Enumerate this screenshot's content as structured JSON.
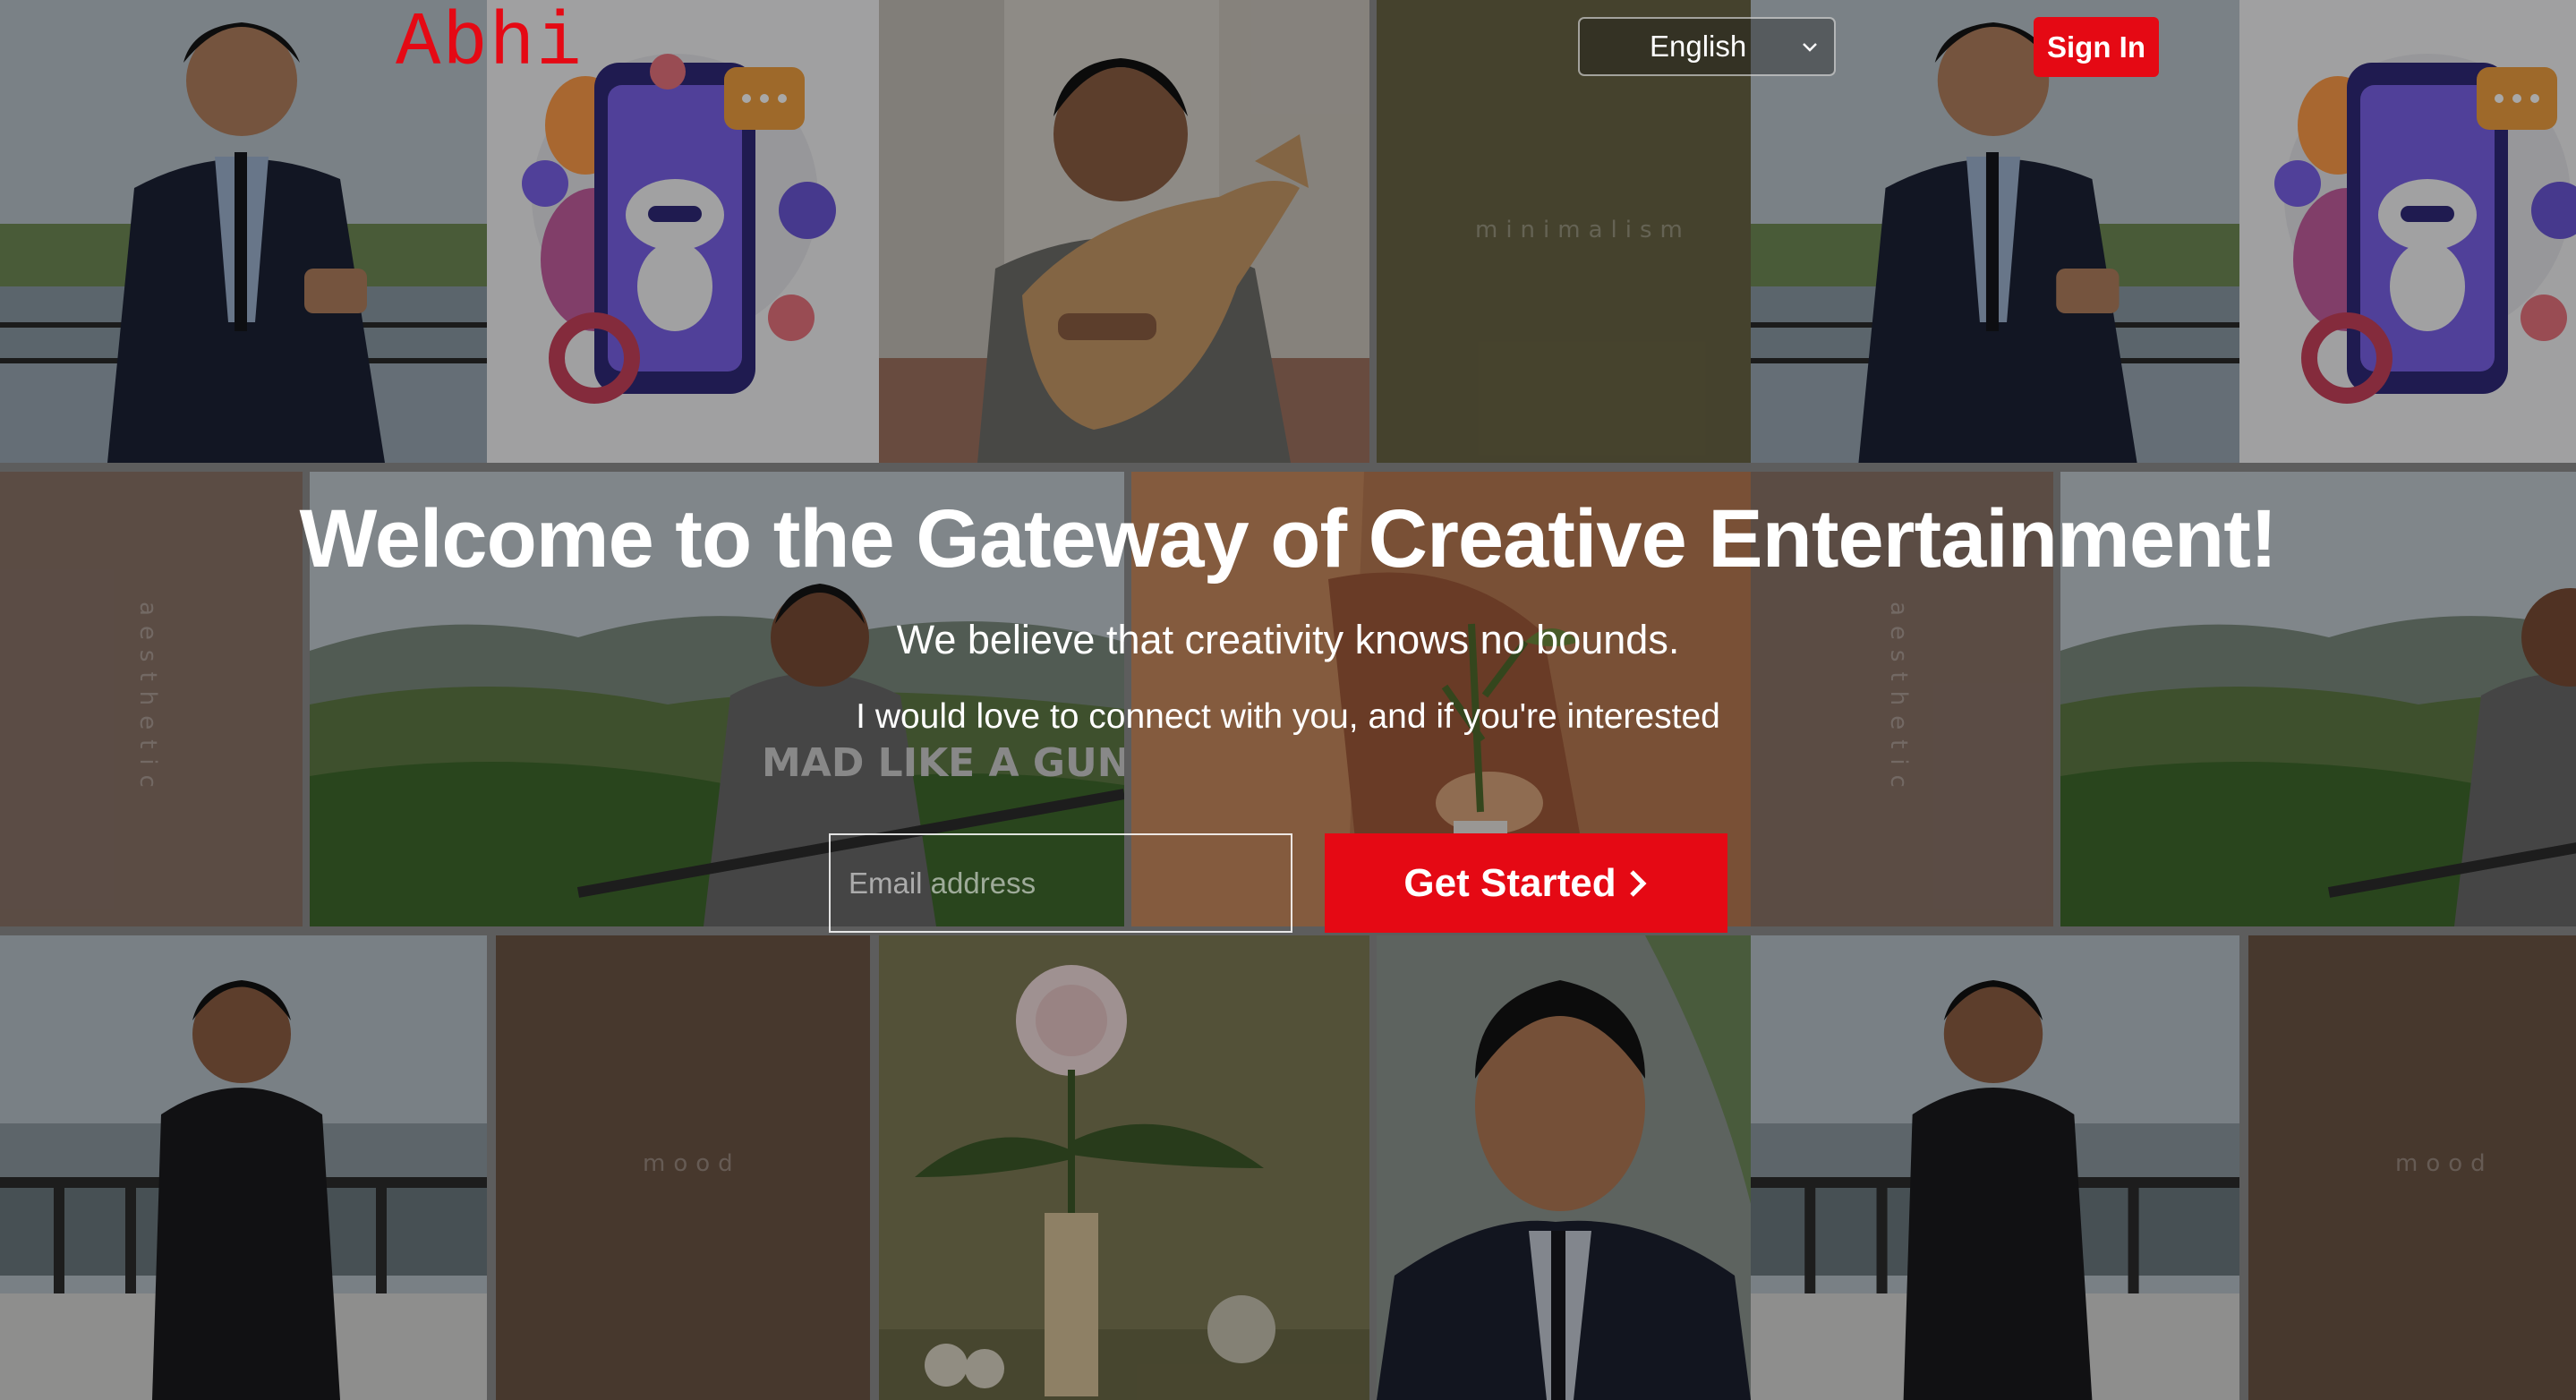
{
  "header": {
    "logo": "Abhi",
    "language": {
      "selected": "English"
    },
    "signin_label": "Sign In"
  },
  "hero": {
    "title": "Welcome to the Gateway of Creative Entertainment!",
    "subtitle": "We believe that creativity knows no bounds.",
    "tagline": "I would love to connect with you, and if you're interested",
    "email_placeholder": "Email address",
    "cta_label": "Get Started"
  },
  "collage": {
    "words": {
      "minimalism": "minimalism",
      "aesthetic": "aesthetic",
      "mood": "mood"
    },
    "photo_shirt_text": "MAD LIKE A GUN"
  },
  "colors": {
    "brand_red": "#e50914"
  },
  "icons": {
    "select_chevron": "chevron-down-icon",
    "cta_arrow": "chevron-right-icon"
  }
}
